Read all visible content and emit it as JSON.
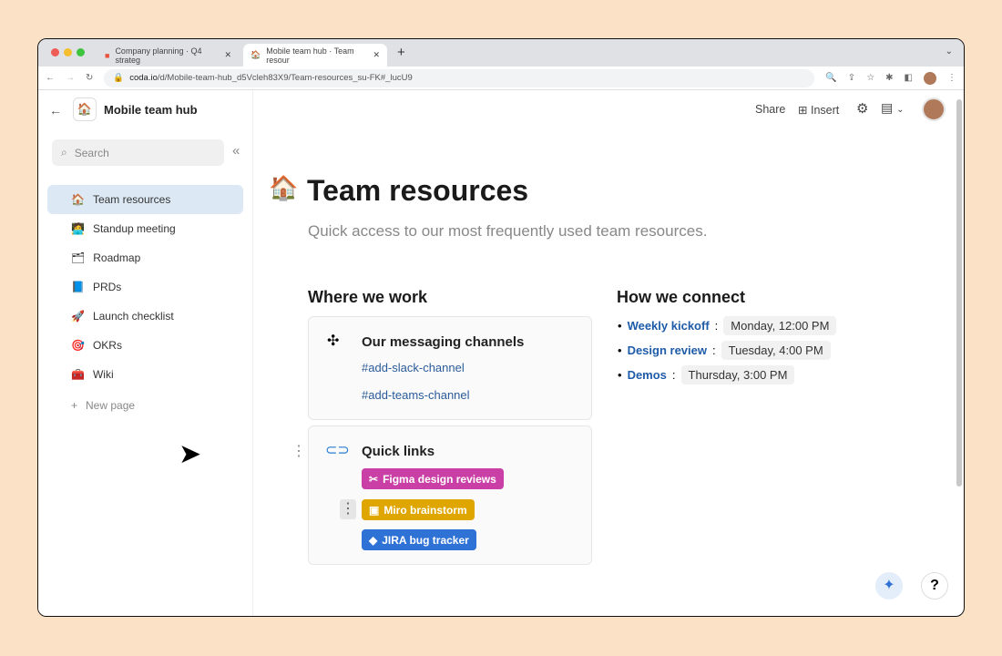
{
  "browser": {
    "tabs": [
      {
        "label": "Company planning · Q4 strateg"
      },
      {
        "label": "Mobile team hub · Team resour"
      }
    ],
    "url_host": "coda.io",
    "url_path": "/d/Mobile-team-hub_d5Vcleh83X9/Team-resources_su-FK#_lucU9"
  },
  "doc": {
    "title": "Mobile team hub"
  },
  "sidebar": {
    "search_placeholder": "Search",
    "items": [
      {
        "label": "Team resources",
        "icon": "🏠"
      },
      {
        "label": "Standup meeting",
        "icon": "🧑‍💻"
      },
      {
        "label": "Roadmap",
        "icon": "🗂"
      },
      {
        "label": "PRDs",
        "icon": "📘"
      },
      {
        "label": "Launch checklist",
        "icon": "🚀"
      },
      {
        "label": "OKRs",
        "icon": "🎯"
      },
      {
        "label": "Wiki",
        "icon": "🧰"
      }
    ],
    "new_page": "New page"
  },
  "toolbar": {
    "share": "Share",
    "insert": "Insert"
  },
  "page": {
    "title": "Team resources",
    "subtitle": "Quick access to our most frequently used team resources."
  },
  "where": {
    "heading": "Where we work",
    "messaging": {
      "title": "Our messaging channels",
      "links": [
        "#add-slack-channel",
        "#add-teams-channel"
      ]
    },
    "quick": {
      "title": "Quick links",
      "chips": [
        {
          "label": "Figma design reviews",
          "color": "#c93fa6"
        },
        {
          "label": "Miro brainstorm",
          "color": "#e0a600"
        },
        {
          "label": "JIRA bug tracker",
          "color": "#2f72d6"
        }
      ]
    }
  },
  "connect": {
    "heading": "How we connect",
    "items": [
      {
        "name": "Weekly kickoff",
        "time": "Monday, 12:00 PM"
      },
      {
        "name": "Design review",
        "time": "Tuesday, 4:00 PM"
      },
      {
        "name": "Demos",
        "time": "Thursday, 3:00 PM"
      }
    ]
  },
  "help": "?"
}
